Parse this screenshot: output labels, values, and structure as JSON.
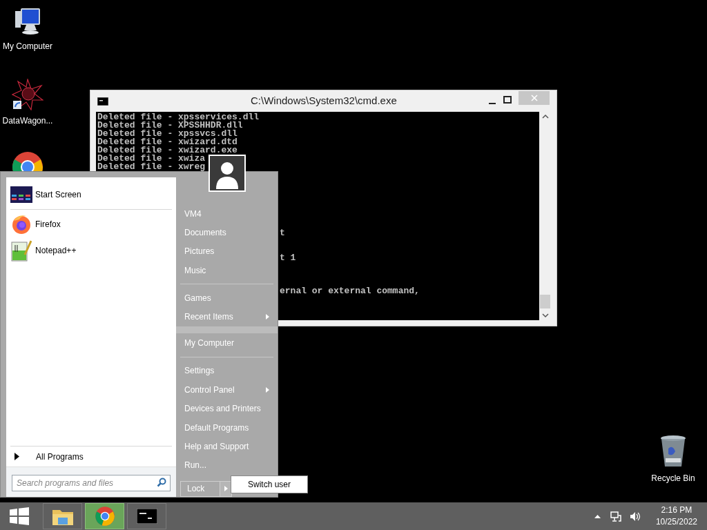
{
  "desktop_icons": [
    {
      "kind": "computer",
      "label": "My Computer"
    },
    {
      "kind": "star",
      "label": "DataWagon..."
    },
    {
      "kind": "chrome"
    }
  ],
  "recycle_bin": {
    "label": "Recycle Bin"
  },
  "cmd_window": {
    "title": "C:\\Windows\\System32\\cmd.exe",
    "lines": [
      {
        "kind": "line",
        "text": "Deleted file - xpsservices.dll"
      },
      {
        "kind": "line",
        "text": "Deleted file - XPSSHHDR.dll"
      },
      {
        "kind": "line",
        "text": "Deleted file - xpssvcs.dll"
      },
      {
        "kind": "line",
        "text": "Deleted file - xwizard.dtd"
      },
      {
        "kind": "line",
        "text": "Deleted file - xwizard.exe"
      },
      {
        "kind": "line",
        "text": "Deleted file - xwiza"
      },
      {
        "kind": "line",
        "text": "Deleted file - xwreg"
      },
      {
        "kind": "hidden"
      },
      {
        "kind": "hidden"
      },
      {
        "kind": "hidden"
      },
      {
        "kind": "hidden"
      },
      {
        "kind": "hidden"
      },
      {
        "kind": "hidden"
      },
      {
        "kind": "hidden"
      },
      {
        "kind": "tail",
        "text": "t"
      },
      {
        "kind": "hidden"
      },
      {
        "kind": "hidden"
      },
      {
        "kind": "tail",
        "text": "t 1"
      },
      {
        "kind": "hidden"
      },
      {
        "kind": "hidden"
      },
      {
        "kind": "hidden"
      },
      {
        "kind": "tail",
        "text": "ernal or external command,"
      }
    ]
  },
  "start_menu": {
    "pinned": [
      {
        "kind": "tile",
        "label": "Start Screen"
      },
      {
        "kind": "firefox",
        "label": "Firefox"
      },
      {
        "kind": "notepad",
        "label": "Notepad++"
      }
    ],
    "all_programs": "All Programs",
    "search": {
      "placeholder": "Search programs and files"
    },
    "places": [
      {
        "kind": "item",
        "label": "VM4"
      },
      {
        "kind": "item",
        "label": "Documents"
      },
      {
        "kind": "item",
        "label": "Pictures"
      },
      {
        "kind": "item",
        "label": "Music"
      },
      {
        "kind": "separator"
      },
      {
        "kind": "item",
        "label": "Games"
      },
      {
        "kind": "submenu",
        "label": "Recent Items"
      },
      {
        "kind": "band"
      },
      {
        "kind": "item",
        "label": "My Computer"
      },
      {
        "kind": "separator"
      },
      {
        "kind": "item",
        "label": "Settings"
      },
      {
        "kind": "submenu",
        "label": "Control Panel"
      },
      {
        "kind": "item",
        "label": "Devices and Printers"
      },
      {
        "kind": "item",
        "label": "Default Programs"
      },
      {
        "kind": "item",
        "label": "Help and Support"
      },
      {
        "kind": "item",
        "label": "Run..."
      }
    ],
    "lock": "Lock",
    "popup": "Switch user"
  },
  "taskbar": {
    "apps": [
      {
        "kind": "folder",
        "selected": false
      },
      {
        "kind": "chrome",
        "selected": true
      },
      {
        "kind": "cmd",
        "selected": false
      }
    ],
    "time": "2:16 PM",
    "date": "10/25/2022"
  }
}
